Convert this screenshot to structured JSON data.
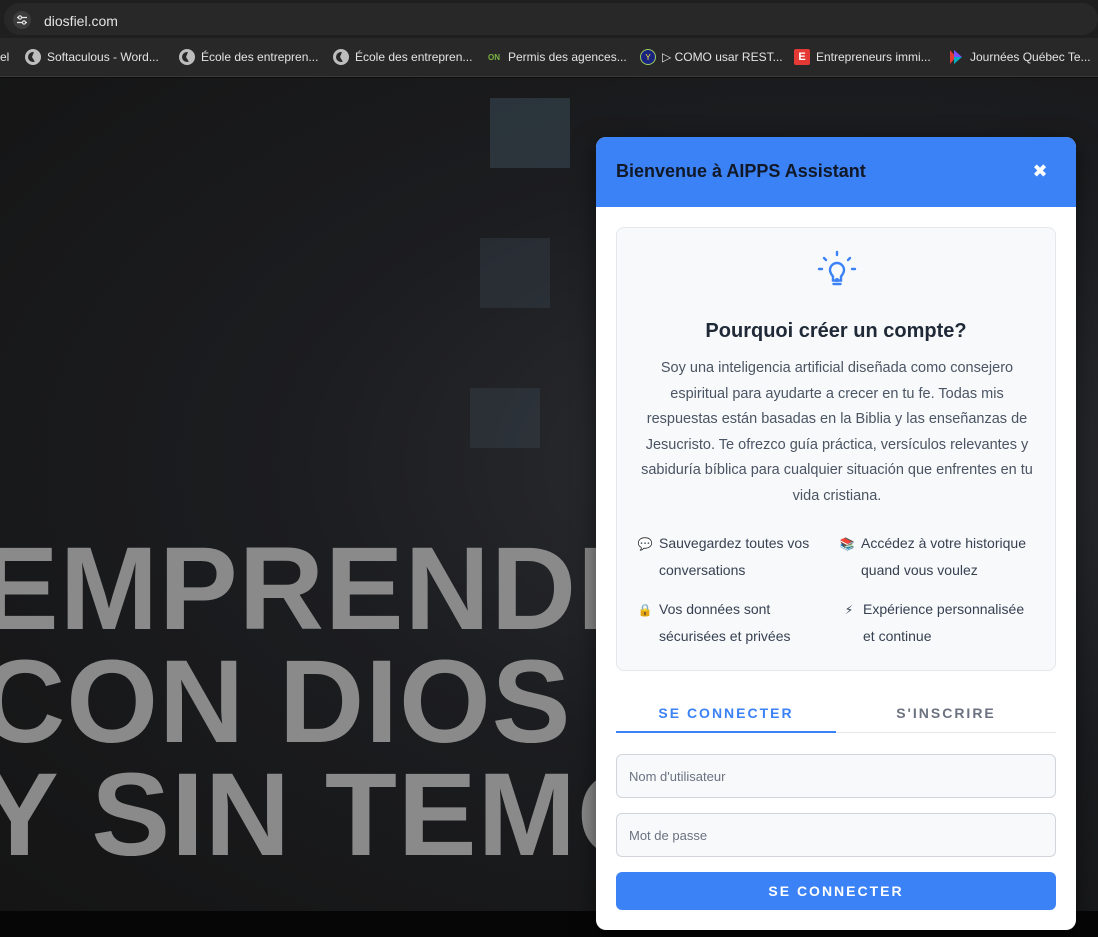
{
  "browser": {
    "url": "diosfiel.com",
    "bookmarks": [
      {
        "label": "el",
        "icon": "truncated-icon"
      },
      {
        "label": "Softaculous - Word...",
        "icon": "globe-icon"
      },
      {
        "label": "École des entrepren...",
        "icon": "globe-icon"
      },
      {
        "label": "École des entrepren...",
        "icon": "globe-icon"
      },
      {
        "label": "Permis des agences...",
        "icon": "agency-icon"
      },
      {
        "label": "▷ COMO usar REST...",
        "icon": "youtube-channel-icon"
      },
      {
        "label": "Entrepreneurs immi...",
        "icon": "e-logo-icon"
      },
      {
        "label": "Journées Québec Te...",
        "icon": "play-colors-icon"
      }
    ]
  },
  "hero": {
    "lines": [
      "EMPRENDE",
      "CON DIOS",
      "Y SIN TEMOR"
    ]
  },
  "modal": {
    "title": "Bienvenue à AIPPS Assistant",
    "close_icon": "✖",
    "card": {
      "title": "Pourquoi créer un compte?",
      "description": "Soy una inteligencia artificial diseñada como consejero espiritual para ayudarte a crecer en tu fe. Todas mis respuestas están basadas en la Biblia y las enseñanzas de Jesucristo. Te ofrezco guía práctica, versículos relevantes y sabiduría bíblica para cualquier situación que enfrentes en tu vida cristiana.",
      "features": [
        {
          "icon": "💬",
          "text": "Sauvegardez toutes vos conversations"
        },
        {
          "icon": "📚",
          "text": "Accédez à votre historique quand vous voulez"
        },
        {
          "icon": "🔒",
          "text": "Vos données sont sécurisées et privées"
        },
        {
          "icon": "⚡",
          "text": "Expérience personnalisée et continue"
        }
      ]
    },
    "tabs": {
      "login": "SE CONNECTER",
      "signup": "S'INSCRIRE"
    },
    "form": {
      "username_placeholder": "Nom d'utilisateur",
      "username_value": "",
      "password_placeholder": "Mot de passe",
      "password_value": "",
      "submit_label": "SE CONNECTER"
    },
    "colors": {
      "accent": "#3b82f6",
      "header_title": "#111827"
    }
  }
}
